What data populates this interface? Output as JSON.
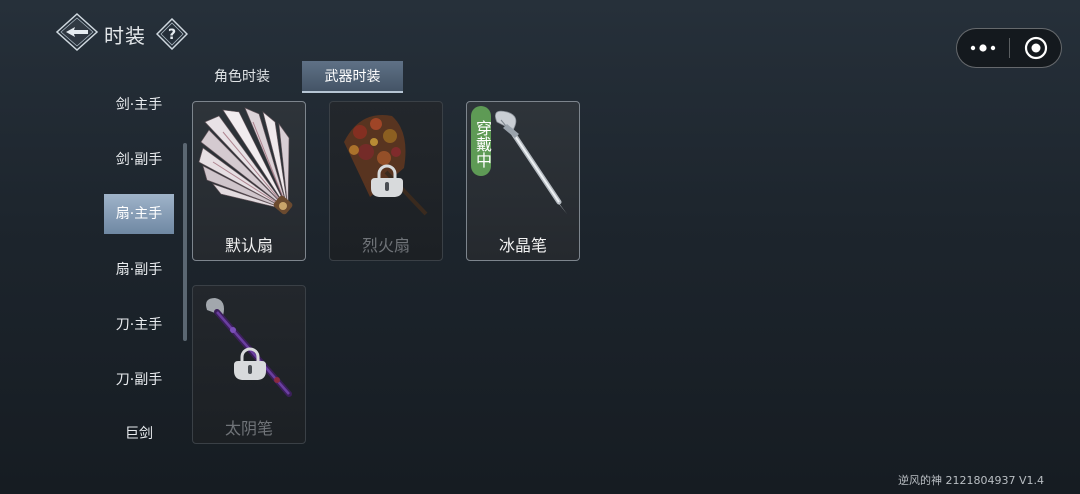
{
  "header": {
    "title": "时装",
    "back_icon": "diamond-back-arrow-icon",
    "help_icon": "diamond-question-icon",
    "help_glyph": "?"
  },
  "capsule": {
    "more_icon": "more-dots-icon",
    "close_icon": "target-circle-icon"
  },
  "tabs": [
    {
      "label": "角色时装",
      "active": false
    },
    {
      "label": "武器时装",
      "active": true
    }
  ],
  "sidebar": {
    "items": [
      {
        "label": "剑·主手",
        "selected": false
      },
      {
        "label": "剑·副手",
        "selected": false
      },
      {
        "label": "扇·主手",
        "selected": true
      },
      {
        "label": "扇·副手",
        "selected": false
      },
      {
        "label": "刀·主手",
        "selected": false
      },
      {
        "label": "刀·副手",
        "selected": false
      },
      {
        "label": "巨剑",
        "selected": false
      }
    ]
  },
  "items": [
    {
      "name": "默认扇",
      "locked": false,
      "equipped": false,
      "art": "feather-fan-icon"
    },
    {
      "name": "烈火扇",
      "locked": true,
      "equipped": false,
      "art": "fire-fan-icon"
    },
    {
      "name": "冰晶笔",
      "locked": false,
      "equipped": true,
      "equipped_label": "穿戴中",
      "art": "ice-brush-icon"
    },
    {
      "name": "太阴笔",
      "locked": true,
      "equipped": false,
      "art": "purple-brush-icon"
    }
  ],
  "colors": {
    "accent": "#6f88a3",
    "equipped_badge": "#5e9a55",
    "tab_active": "#506174"
  },
  "footer": {
    "text": "逆风的神 2121804937 V1.4"
  }
}
